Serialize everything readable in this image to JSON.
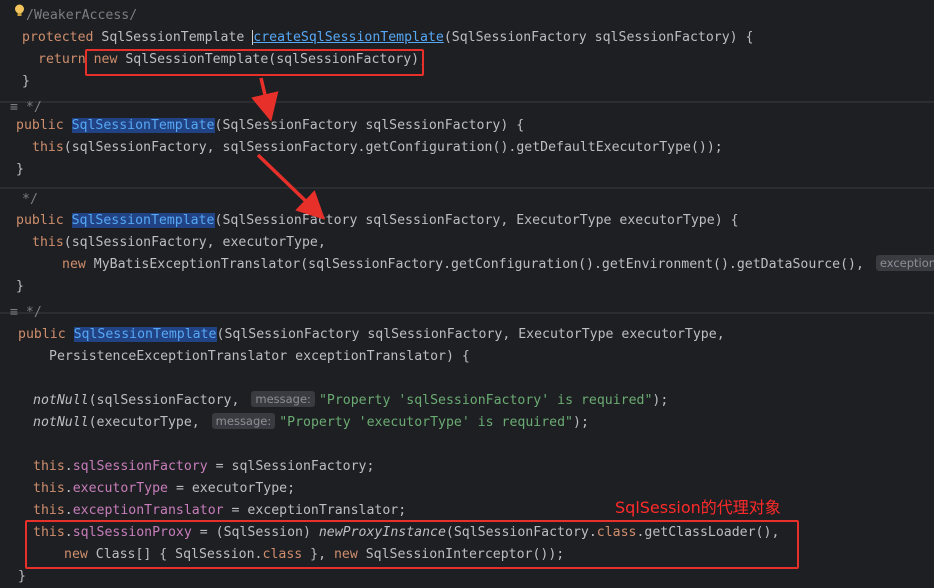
{
  "panel1": {
    "comment": "/WeakerAccess/",
    "sig_kw": "protected ",
    "sig_type": "SqlSessionTemplate ",
    "sig_name": "createSqlSessionTemplate",
    "sig_params": "(SqlSessionFactory sqlSessionFactory) {",
    "ret_kw": "return ",
    "ret_new": "new ",
    "ret_rest": "SqlSessionTemplate(sqlSessionFactory);",
    "close": "}"
  },
  "panel2": {
    "comment": "*/",
    "sig_kw": "public ",
    "sig_name": "SqlSessionTemplate",
    "sig_params": "(SqlSessionFactory sqlSessionFactory) {",
    "body_kw": "this",
    "body_rest": "(sqlSessionFactory, sqlSessionFactory.getConfiguration().getDefaultExecutorType());",
    "close": "}"
  },
  "panel3": {
    "comment": "*/",
    "sig_kw": "public ",
    "sig_name": "SqlSessionTemplate",
    "sig_params": "(SqlSessionFactory sqlSessionFactory, ExecutorType executorType) {",
    "body1_kw": "this",
    "body1_rest": "(sqlSessionFactory, executorType,",
    "body2_kw": "new ",
    "body2_rest": "MyBatisExceptionTranslator(sqlSessionFactory.getConfiguration().getEnvironment().getDataSource(), ",
    "body2_hint": "exceptionTra",
    "close": "}"
  },
  "panel4": {
    "comment": "*/",
    "sig_kw": "public ",
    "sig_name": "SqlSessionTemplate",
    "sig_params1": "(SqlSessionFactory sqlSessionFactory, ExecutorType executorType,",
    "sig_params2": "PersistenceExceptionTranslator exceptionTranslator) {",
    "nn1_fn": "notNull",
    "nn1_arg": "(sqlSessionFactory, ",
    "nn1_hint": "message:",
    "nn1_str": "\"Property 'sqlSessionFactory' is required\"",
    "nn1_end": ");",
    "nn2_fn": "notNull",
    "nn2_arg": "(executorType, ",
    "nn2_hint": "message:",
    "nn2_str": "\"Property 'executorType' is required\"",
    "nn2_end": ");",
    "this_kw": "this",
    "a1_field": "sqlSessionFactory",
    "a1_rest": " = sqlSessionFactory;",
    "a2_field": "executorType",
    "a2_rest": " = executorType;",
    "a3_field": "exceptionTranslator",
    "a3_rest": " = exceptionTranslator;",
    "a4_field": "sqlSessionProxy",
    "a4_mid": " = (SqlSession) ",
    "a4_fn": "newProxyInstance",
    "a4_rest1": "(SqlSessionFactory.",
    "a4_class": "class",
    "a4_rest2": ".getClassLoader(),",
    "a5_new": "new ",
    "a5_mid": "Class[] { SqlSession.",
    "a5_class": "class",
    "a5_mid2": " }, ",
    "a5_new2": "new ",
    "a5_rest": "SqlSessionInterceptor());",
    "close": "}"
  },
  "annotation": {
    "note": "SqlSession的代理对象",
    "accent": "#e8302a"
  }
}
